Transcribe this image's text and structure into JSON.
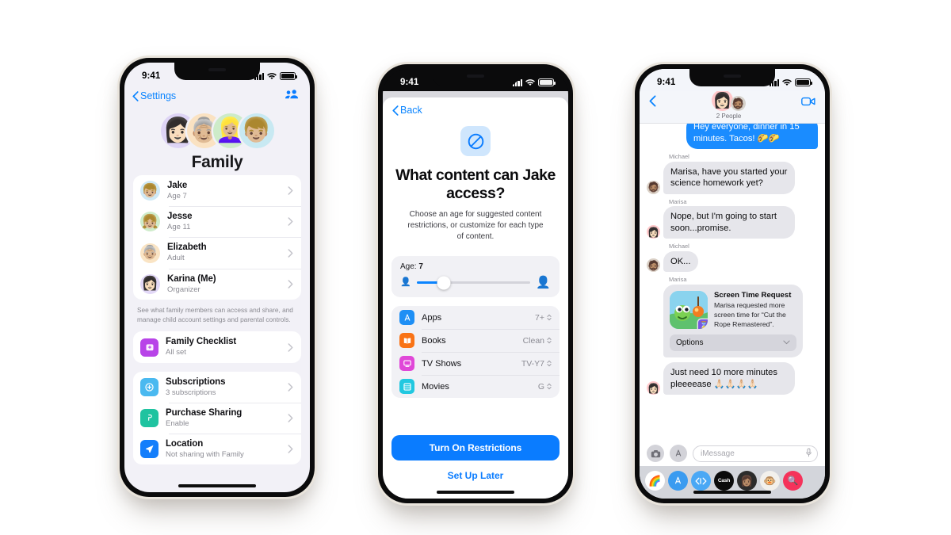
{
  "phones": [
    {
      "id": "family-settings",
      "status_bar": {
        "time": "9:41",
        "signal": "cellular-bars",
        "wifi": "wifi-icon",
        "battery": "battery-full"
      },
      "nav": {
        "back_label": "Settings",
        "right_icon": "add-family-member-icon"
      },
      "header": {
        "title": "Family",
        "avatars": [
          "👩🏻",
          "👵🏼",
          "👱🏼‍♀️",
          "👦🏼"
        ],
        "avatar_bgs": [
          "#ded4f5",
          "#fae2c2",
          "#cdebc9",
          "#c8e9f2"
        ]
      },
      "members": [
        {
          "name": "Jake",
          "detail": "Age 7",
          "emoji": "👦🏼",
          "bg": "#cfe9f5"
        },
        {
          "name": "Jesse",
          "detail": "Age 11",
          "emoji": "👧🏼",
          "bg": "#cfeccb"
        },
        {
          "name": "Elizabeth",
          "detail": "Adult",
          "emoji": "👵🏼",
          "bg": "#fae4c4"
        },
        {
          "name": "Karina (Me)",
          "detail": "Organizer",
          "emoji": "👩🏻",
          "bg": "#e2d8f7"
        }
      ],
      "footnote": "See what family members can access and share, and manage child account settings and parental controls.",
      "checklist": [
        {
          "name": "Family Checklist",
          "detail": "All set",
          "icon": "checklist-icon",
          "color": "#b844e8"
        }
      ],
      "options": [
        {
          "name": "Subscriptions",
          "detail": "3 subscriptions",
          "icon": "subscriptions-icon",
          "color": "#4ab9f0"
        },
        {
          "name": "Purchase Sharing",
          "detail": "Enable",
          "icon": "purchase-sharing-icon",
          "color": "#1fc3a0"
        },
        {
          "name": "Location",
          "detail": "Not sharing with Family",
          "icon": "location-icon",
          "color": "#147efb"
        }
      ]
    },
    {
      "id": "content-restrictions",
      "status_bar": {
        "time": "9:41"
      },
      "nav": {
        "back_label": "Back"
      },
      "icon": "restriction-circle-slash-icon",
      "title": "What content can Jake access?",
      "subtitle": "Choose an age for suggested content restrictions, or customize for each type of content.",
      "age": {
        "label": "Age:",
        "value": "7",
        "slider_percent": 24
      },
      "ratings": [
        {
          "name": "Apps",
          "value": "7+",
          "icon": "app-store-icon",
          "color": "#1e8ff5"
        },
        {
          "name": "Books",
          "value": "Clean",
          "icon": "books-icon",
          "color": "#f97316"
        },
        {
          "name": "TV Shows",
          "value": "TV-Y7",
          "icon": "tv-icon",
          "color": "#e048d8"
        },
        {
          "name": "Movies",
          "value": "G",
          "icon": "movies-icon",
          "color": "#22c8e0"
        }
      ],
      "primary_button": "Turn On Restrictions",
      "secondary_button": "Set Up Later"
    },
    {
      "id": "messages-thread",
      "status_bar": {
        "time": "9:41"
      },
      "header": {
        "participants_label": "2 People",
        "back_icon": "back-chevron-icon",
        "facetime_icon": "facetime-video-icon"
      },
      "messages": [
        {
          "sender": "",
          "side": "out",
          "text": "Hey everyone, dinner in 15 minutes. Tacos! 🌮🌮"
        },
        {
          "sender": "Michael",
          "side": "in",
          "text": "Marisa, have you started your science homework yet?",
          "emoji": "🧔🏽",
          "bg": "#d9cfc5"
        },
        {
          "sender": "Marisa",
          "side": "in",
          "text": "Nope, but I'm going to start soon...promise.",
          "emoji": "👩🏻",
          "bg": "#ffc9cb"
        },
        {
          "sender": "Michael",
          "side": "in",
          "text": "OK...",
          "emoji": "🧔🏽",
          "bg": "#d9cfc5"
        }
      ],
      "screen_time_request": {
        "sender": "Marisa",
        "title": "Screen Time Request",
        "body": "Marisa requested more screen time for “Cut the Rope Remastered”.",
        "options_label": "Options",
        "app_icon": "cut-the-rope-app-icon",
        "badge_icon": "screen-time-badge-icon"
      },
      "last_message": {
        "sender": "Marisa",
        "text": "Just need 10 more minutes pleeeease 🙏🏻🙏🏻🙏🏻🙏🏻",
        "emoji": "👩🏻",
        "bg": "#ffc9cb"
      },
      "input": {
        "placeholder": "iMessage",
        "camera_icon": "camera-icon",
        "apps_icon": "app-store-drawer-icon",
        "mic_icon": "microphone-icon"
      },
      "app_drawer": [
        {
          "name": "photos-app",
          "emoji": "🌈",
          "bg": "#ffffff"
        },
        {
          "name": "app-store-app",
          "emoji": "Ⓐ",
          "bg": "#3a9bf0"
        },
        {
          "name": "digital-touch-app",
          "emoji": "◀▶",
          "bg": "#4aa8f5"
        },
        {
          "name": "apple-cash-app",
          "emoji": "Cash",
          "bg": "#0b0b0b"
        },
        {
          "name": "memoji-stickers-app",
          "emoji": "👩🏽",
          "bg": "#2c2c2c"
        },
        {
          "name": "animoji-app",
          "emoji": "🐵",
          "bg": "#f2f0ec"
        },
        {
          "name": "image-search-app",
          "emoji": "🔍",
          "bg": "#f5325b"
        }
      ]
    }
  ]
}
